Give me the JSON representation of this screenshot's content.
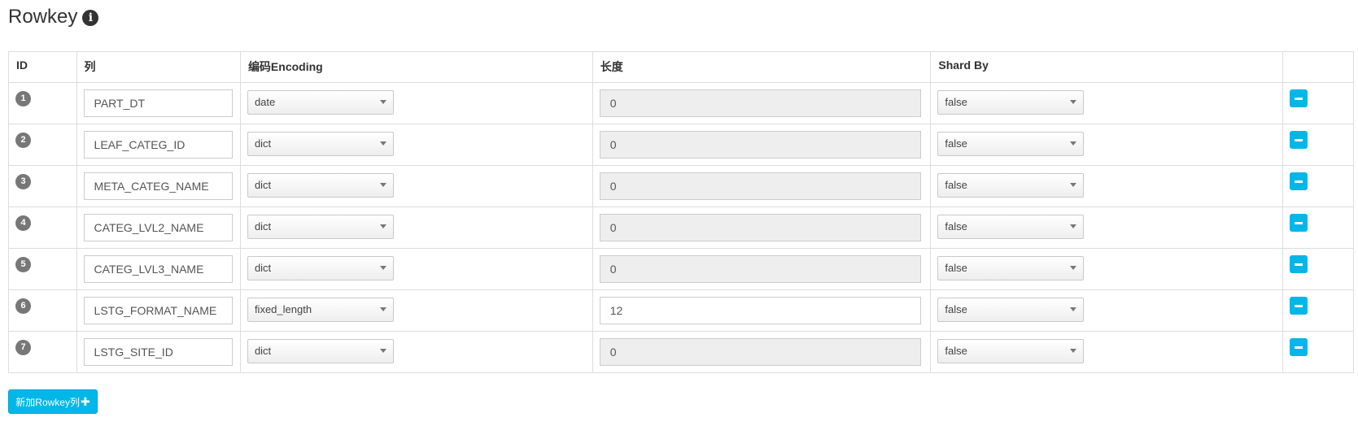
{
  "header": {
    "title": "Rowkey",
    "info_icon": "info-icon"
  },
  "table": {
    "columns": [
      "ID",
      "列",
      "编码Encoding",
      "长度",
      "Shard By",
      ""
    ],
    "rows": [
      {
        "id": "1",
        "column": "PART_DT",
        "encoding": "date",
        "length": "0",
        "length_editable": false,
        "shard_by": "false"
      },
      {
        "id": "2",
        "column": "LEAF_CATEG_ID",
        "encoding": "dict",
        "length": "0",
        "length_editable": false,
        "shard_by": "false"
      },
      {
        "id": "3",
        "column": "META_CATEG_NAME",
        "encoding": "dict",
        "length": "0",
        "length_editable": false,
        "shard_by": "false"
      },
      {
        "id": "4",
        "column": "CATEG_LVL2_NAME",
        "encoding": "dict",
        "length": "0",
        "length_editable": false,
        "shard_by": "false"
      },
      {
        "id": "5",
        "column": "CATEG_LVL3_NAME",
        "encoding": "dict",
        "length": "0",
        "length_editable": false,
        "shard_by": "false"
      },
      {
        "id": "6",
        "column": "LSTG_FORMAT_NAME",
        "encoding": "fixed_length",
        "length": "12",
        "length_editable": true,
        "shard_by": "false"
      },
      {
        "id": "7",
        "column": "LSTG_SITE_ID",
        "encoding": "dict",
        "length": "0",
        "length_editable": false,
        "shard_by": "false"
      }
    ]
  },
  "add_button": {
    "label": "新加Rowkey列",
    "icon": "plus-icon"
  },
  "colors": {
    "accent": "#00b7e8",
    "badge": "#777777",
    "disabled_input": "#eeeeee",
    "border": "#dddddd"
  }
}
